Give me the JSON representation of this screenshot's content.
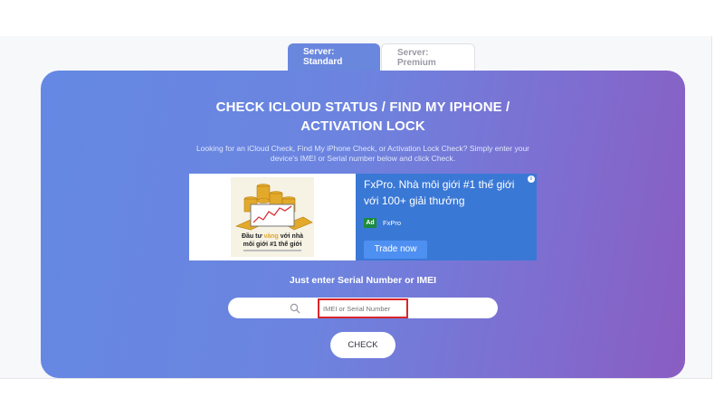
{
  "tabs": [
    {
      "label": "Server: Standard",
      "active": true
    },
    {
      "label": "Server: Premium",
      "active": false
    }
  ],
  "hero": {
    "title_line1": "CHECK ICLOUD STATUS / FIND MY IPHONE /",
    "title_line2": "ACTIVATION LOCK",
    "description_line1": "Looking for an iCloud Check, Find My iPhone Check, or Activation Lock Check? Simply enter your",
    "description_line2": "device's IMEI or Serial number below and click Check."
  },
  "ad": {
    "image_text_part1": "Đầu tư ",
    "image_text_highlight": "vàng",
    "image_text_part2": " với nhà",
    "image_text_line2": "môi giới #1 thế giới",
    "headline": "FxPro. Nhà môi giới #1 thế giới với 100+ giải thưởng",
    "badge": "Ad",
    "brand": "FxPro",
    "cta_label": "Trade now",
    "colors": {
      "panel": "#3a78d6",
      "cta": "#4e90f2",
      "badge": "#1c8b3c"
    }
  },
  "form": {
    "label": "Just enter Serial Number or IMEI",
    "search_icon": "search-icon",
    "input_placeholder": "IMEI or Serial Number",
    "input_value": "",
    "check_label": "CHECK",
    "highlight_color": "#d9262b"
  }
}
